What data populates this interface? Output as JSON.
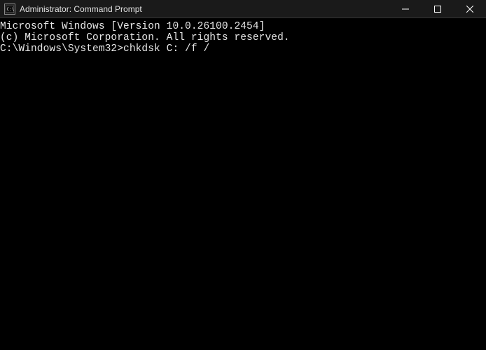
{
  "window": {
    "title": "Administrator: Command Prompt"
  },
  "terminal": {
    "line1": "Microsoft Windows [Version 10.0.26100.2454]",
    "line2": "(c) Microsoft Corporation. All rights reserved.",
    "blank": "",
    "prompt_path": "C:\\Windows\\System32>",
    "command": "chkdsk C: /f /"
  }
}
